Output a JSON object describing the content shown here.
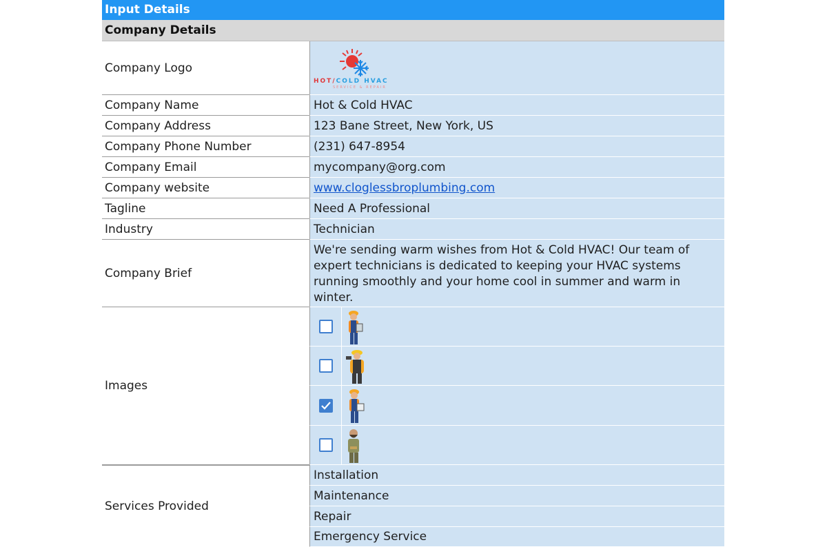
{
  "header": {
    "title": "Input Details"
  },
  "section": {
    "title": "Company Details"
  },
  "rows": {
    "logo": {
      "label": "Company Logo",
      "logo_text_hot": "HOT/",
      "logo_text_cold": "COLD HVAC",
      "logo_sub": "SERVICE & REPAIR"
    },
    "name": {
      "label": "Company Name",
      "value": "Hot & Cold HVAC"
    },
    "address": {
      "label": "Company Address",
      "value": "123 Bane Street, New York, US"
    },
    "phone": {
      "label": "Company Phone Number",
      "value": "(231) 647-8954"
    },
    "email": {
      "label": "Company Email",
      "value": "mycompany@org.com"
    },
    "website": {
      "label": "Company website",
      "value": "www.cloglessbroplumbing.com"
    },
    "tagline": {
      "label": "Tagline",
      "value": "Need A Professional"
    },
    "industry": {
      "label": "Industry",
      "value": "Technician"
    },
    "brief": {
      "label": "Company Brief",
      "value": "We're sending warm wishes from Hot & Cold HVAC! Our team of expert technicians is dedicated to keeping your HVAC systems running smoothly and your home cool in summer and warm in winter."
    },
    "images": {
      "label": "Images",
      "items": [
        {
          "checked": false,
          "icon": "technician-tablet-icon"
        },
        {
          "checked": false,
          "icon": "technician-drill-icon"
        },
        {
          "checked": true,
          "icon": "technician-clipboard-icon"
        },
        {
          "checked": false,
          "icon": "technician-bearded-icon"
        }
      ]
    },
    "services": {
      "label": "Services Provided",
      "items": [
        "Installation",
        "Maintenance",
        "Repair",
        "Emergency Service"
      ]
    }
  },
  "colors": {
    "header_blue": "#2296f3",
    "section_gray": "#d8d8d8",
    "value_blue": "#cfe2f3",
    "link": "#1155cc",
    "checkbox": "#3f7fcf"
  }
}
